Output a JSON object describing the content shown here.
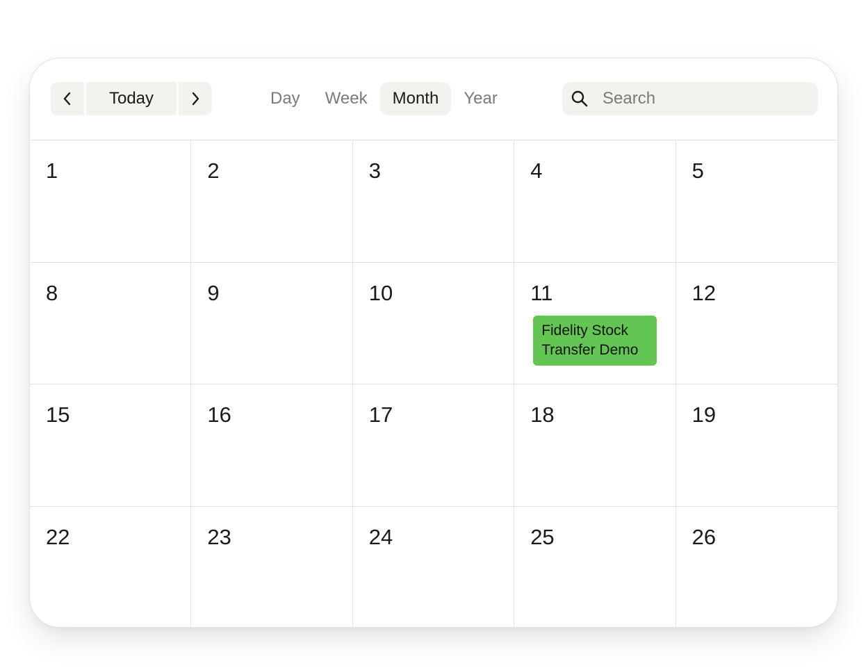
{
  "toolbar": {
    "prev_icon": "chevron-left-icon",
    "today_label": "Today",
    "next_icon": "chevron-right-icon",
    "views": [
      {
        "label": "Day",
        "active": false
      },
      {
        "label": "Week",
        "active": false
      },
      {
        "label": "Month",
        "active": true
      },
      {
        "label": "Year",
        "active": false
      }
    ],
    "search": {
      "icon": "search-icon",
      "placeholder": "Search",
      "value": ""
    }
  },
  "calendar": {
    "days": [
      {
        "num": "1"
      },
      {
        "num": "2"
      },
      {
        "num": "3"
      },
      {
        "num": "4"
      },
      {
        "num": "5"
      },
      {
        "num": "8"
      },
      {
        "num": "9"
      },
      {
        "num": "10"
      },
      {
        "num": "11",
        "event": "Fidelity Stock Transfer Demo"
      },
      {
        "num": "12"
      },
      {
        "num": "15"
      },
      {
        "num": "16"
      },
      {
        "num": "17"
      },
      {
        "num": "18"
      },
      {
        "num": "19"
      },
      {
        "num": "22"
      },
      {
        "num": "23"
      },
      {
        "num": "24"
      },
      {
        "num": "25"
      },
      {
        "num": "26"
      }
    ]
  },
  "colors": {
    "event_green": "#63c653",
    "control_bg": "#f3f2ef",
    "border": "#e2e2e2"
  }
}
